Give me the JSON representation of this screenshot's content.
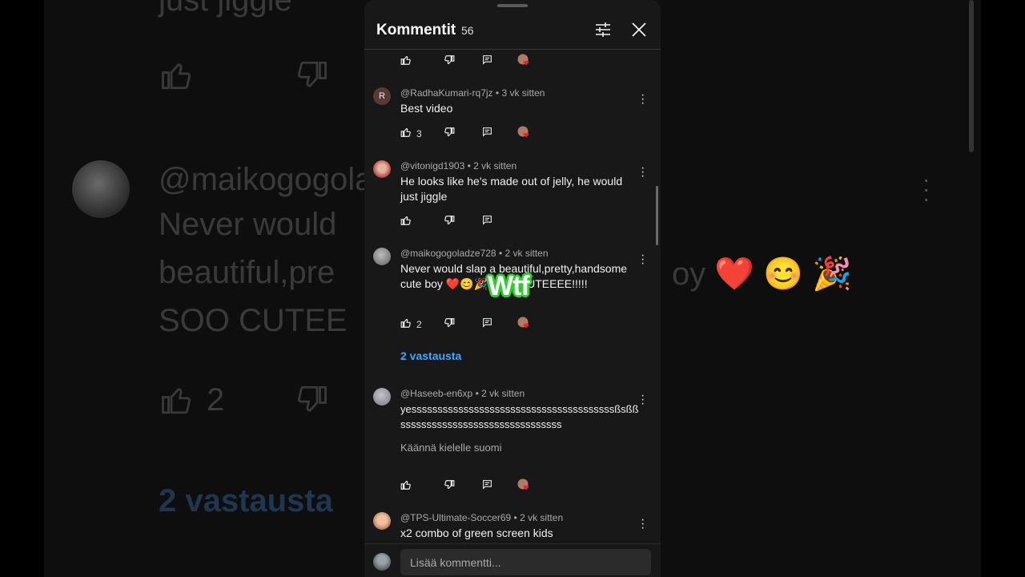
{
  "background": {
    "top_text": "just jiggle",
    "username": "@maikogogola",
    "line1": "Never would",
    "line2": "beautiful,pre",
    "line2_right": "oy ❤️ 😊 🎉",
    "line3": "SOO CUTEE",
    "like_count": "2",
    "replies": "2 vastausta"
  },
  "header": {
    "title": "Kommentit",
    "count": "56"
  },
  "comments": [
    {
      "author": "@RadhaKumari-rq7jz",
      "time": "3 vk sitten",
      "text": "Best video",
      "likes": "3",
      "avatar_letter": "R"
    },
    {
      "author": "@vitonigd1903",
      "time": "2 vk sitten",
      "text": "He looks like he's made out of jelly, he would just jiggle",
      "likes": ""
    },
    {
      "author": "@maikogogoladze728",
      "time": "2 vk sitten",
      "text": "Never would slap a beautiful,pretty,handsome cute boy ❤️😊🎉 SOO CUTEEEE!!!!!",
      "likes": "2",
      "replies": "2 vastausta"
    },
    {
      "author": "@Haseeb-en6xp",
      "time": "2 vk sitten",
      "text": "yesssssssssssssssssssssssssssssssssssssssßsßßsssssssssssssssssssssssssssssss",
      "likes": "",
      "translate": "Käännä kielelle suomi"
    },
    {
      "author": "@TPS-Ultimate-Soccer69",
      "time": "2 vk sitten",
      "text": "x2 combo of green screen kids"
    }
  ],
  "footer": {
    "placeholder": "Lisää kommentti..."
  },
  "overlay": {
    "sticker": "Wtf"
  },
  "colors": {
    "panel": "#181818",
    "link": "#3ea6ff",
    "sticker_outline": "#2fcb2f"
  }
}
